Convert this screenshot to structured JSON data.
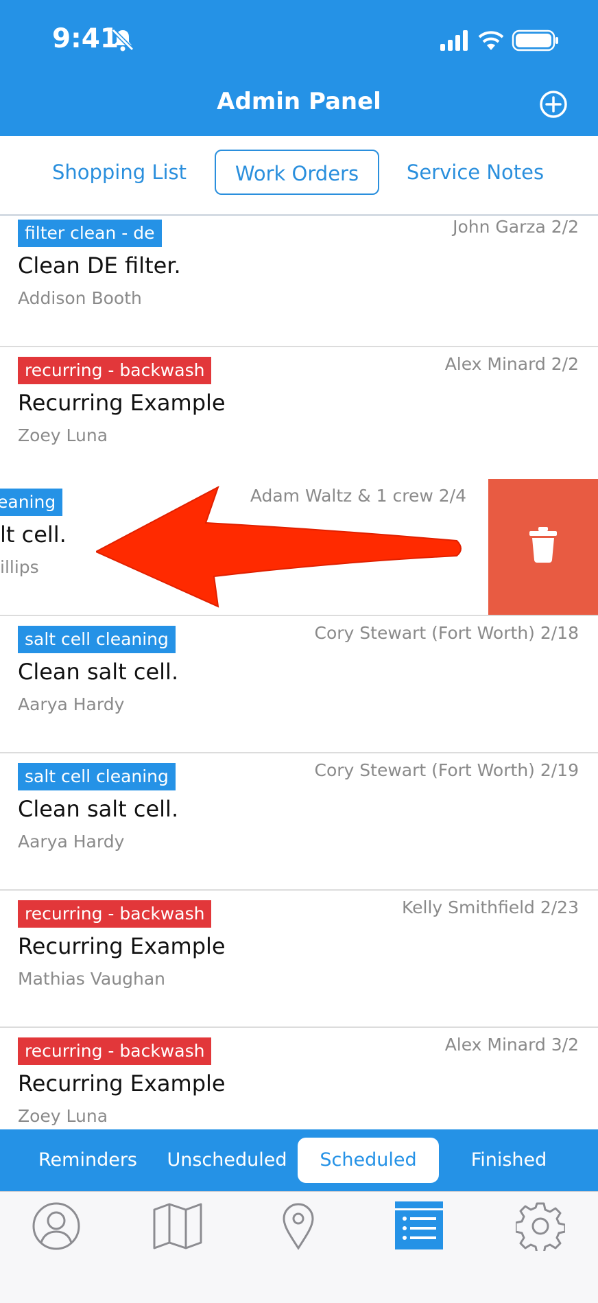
{
  "status": {
    "time": "9:41"
  },
  "header": {
    "title": "Admin Panel"
  },
  "segments": {
    "items": [
      "Shopping List",
      "Work Orders",
      "Service Notes"
    ],
    "active": "Work Orders"
  },
  "work_orders": [
    {
      "tag": "filter clean - de",
      "tag_color": "#2592e6",
      "tech_date": "John Garza 2/2",
      "title": "Clean DE filter.",
      "customer": "Addison Booth"
    },
    {
      "tag": "recurring - backwash",
      "tag_color": "#e2373a",
      "tech_date": "Alex Minard 2/2",
      "title": "Recurring Example",
      "customer": "Zoey Luna"
    },
    {
      "tag": "eaning",
      "tag_color": "#2592e6",
      "tech_date": "Adam Waltz & 1 crew 2/4",
      "title": "lt cell.",
      "customer": "illips",
      "swiped": true
    },
    {
      "tag": "salt cell cleaning",
      "tag_color": "#2592e6",
      "tech_date": "Cory Stewart (Fort Worth) 2/18",
      "title": "Clean salt cell.",
      "customer": "Aarya Hardy"
    },
    {
      "tag": "salt cell cleaning",
      "tag_color": "#2592e6",
      "tech_date": "Cory Stewart (Fort Worth) 2/19",
      "title": "Clean salt cell.",
      "customer": "Aarya Hardy"
    },
    {
      "tag": "recurring - backwash",
      "tag_color": "#e2373a",
      "tech_date": "Kelly Smithfield 2/23",
      "title": "Recurring Example",
      "customer": "Mathias Vaughan"
    },
    {
      "tag": "recurring - backwash",
      "tag_color": "#e2373a",
      "tech_date": "Alex Minard 3/2",
      "title": "Recurring Example",
      "customer": "Zoey Luna"
    }
  ],
  "swipe_action": {
    "icon": "trash-icon",
    "color": "#e85b42"
  },
  "filters": {
    "items": [
      "Reminders",
      "Unscheduled",
      "Scheduled",
      "Finished"
    ],
    "active": "Scheduled"
  },
  "tab_bar": {
    "icons": [
      "person-icon",
      "map-icon",
      "location-pin-icon",
      "list-icon",
      "gear-icon"
    ],
    "active": "list-icon"
  },
  "colors": {
    "primary": "#2592e6",
    "danger": "#e2373a",
    "swipe_delete": "#e85b42"
  }
}
